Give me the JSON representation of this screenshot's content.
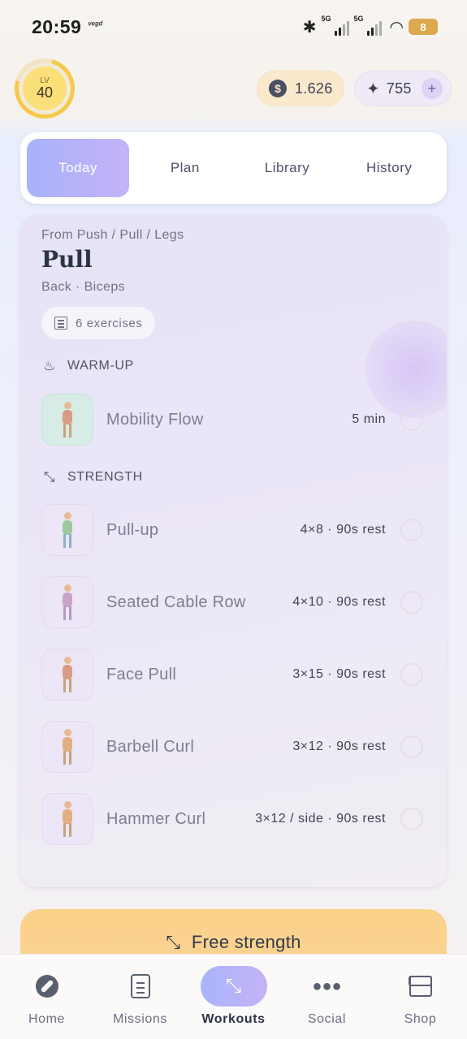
{
  "status_bar": {
    "time": "20:59",
    "small_icon_text": "ᵛᵉᵍᵈ",
    "net1": "5G",
    "net2": "5G",
    "battery": "8"
  },
  "header": {
    "level_prefix": "LV",
    "level": "40",
    "coins": "1.626",
    "coin_symbol": "$",
    "gems": "755",
    "gem_symbol": "✦",
    "plus": "+"
  },
  "tabs": [
    {
      "label": "Today",
      "active": true
    },
    {
      "label": "Plan"
    },
    {
      "label": "Library"
    },
    {
      "label": "History"
    }
  ],
  "workout": {
    "from": "From Push / Pull / Legs",
    "title": "Pull",
    "muscles": "Back · Biceps",
    "exercise_count": "6 exercises",
    "sections": {
      "warmup": "WARM-UP",
      "strength": "STRENGTH"
    },
    "warmup_items": [
      {
        "name": "Mobility Flow",
        "detail": "5 min"
      }
    ],
    "strength_items": [
      {
        "name": "Pull-up",
        "detail": "4×8 · 90s rest"
      },
      {
        "name": "Seated Cable Row",
        "detail": "4×10 · 90s rest"
      },
      {
        "name": "Face Pull",
        "detail": "3×15 · 90s rest"
      },
      {
        "name": "Barbell Curl",
        "detail": "3×12 · 90s rest"
      },
      {
        "name": "Hammer Curl",
        "detail": "3×12 / side · 90s rest"
      }
    ]
  },
  "free_strength": {
    "label": "Free strength"
  },
  "bottom_nav": [
    {
      "label": "Home",
      "icon": "compass-icon"
    },
    {
      "label": "Missions",
      "icon": "clipboard-icon"
    },
    {
      "label": "Workouts",
      "icon": "dumbbell-icon",
      "active": true
    },
    {
      "label": "Social",
      "icon": "group-icon"
    },
    {
      "label": "Shop",
      "icon": "store-icon"
    }
  ]
}
